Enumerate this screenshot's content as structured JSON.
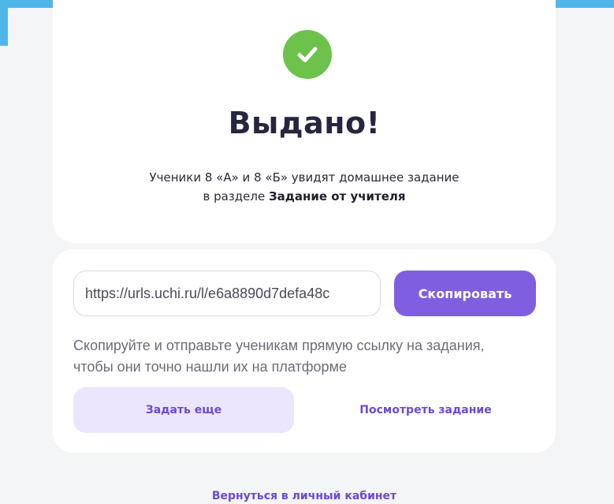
{
  "status": {
    "icon": "check-circle-icon",
    "title": "Выдано!",
    "message_line1": "Ученики 8 «А» и 8 «Б» увидят домашнее задание",
    "message_line2_prefix": "в разделе ",
    "message_line2_bold": "Задание от учителя"
  },
  "share": {
    "link_value": "https://urls.uchi.ru/l/e6a8890d7defa48c",
    "copy_label": "Скопировать",
    "hint_line1": "Скопируйте и отправьте ученикам прямую ссылку на задания,",
    "hint_line2": "чтобы они точно нашли их на платформе"
  },
  "actions": {
    "assign_again_label": "Задать еще",
    "view_task_label": "Посмотреть задание"
  },
  "footer": {
    "back_label": "Вернуться в личный кабинет"
  },
  "colors": {
    "accent": "#7f5fe0",
    "success": "#6cc24a",
    "accent_light": "#ebe6fd",
    "frame": "#4fb6ea"
  }
}
